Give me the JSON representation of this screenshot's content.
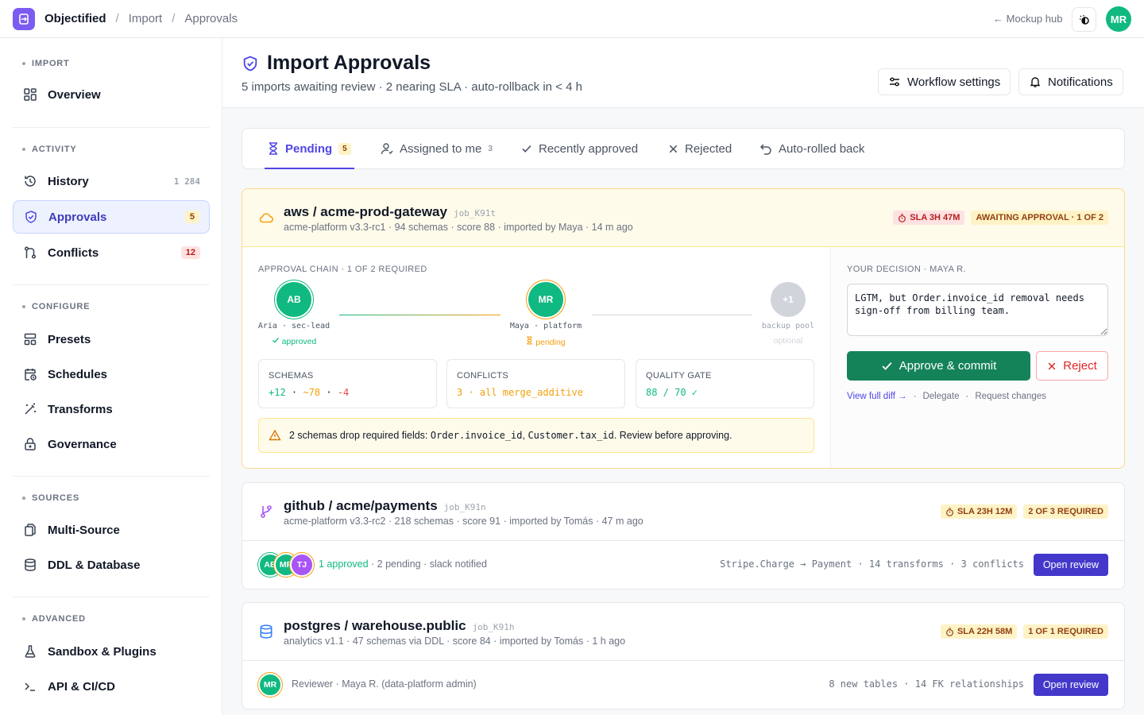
{
  "topbar": {
    "app_name": "Objectified",
    "crumb_import": "Import",
    "crumb_approvals": "Approvals",
    "separator": "/",
    "mockup_hub": "← Mockup hub",
    "user_initials": "MR"
  },
  "sidebar": {
    "sections": {
      "import": "IMPORT",
      "activity": "ACTIVITY",
      "configure": "CONFIGURE",
      "sources": "SOURCES",
      "advanced": "ADVANCED"
    },
    "items": {
      "overview": "Overview",
      "history": "History",
      "history_count": "1 284",
      "approvals": "Approvals",
      "approvals_count": "5",
      "conflicts": "Conflicts",
      "conflicts_count": "12",
      "presets": "Presets",
      "schedules": "Schedules",
      "transforms": "Transforms",
      "governance": "Governance",
      "multi_source": "Multi-Source",
      "ddl_database": "DDL & Database",
      "sandbox": "Sandbox & Plugins",
      "api": "API & CI/CD"
    }
  },
  "header": {
    "title": "Import Approvals",
    "subtitle": "5 imports awaiting review · 2 nearing SLA · auto-rollback in < 4 h",
    "workflow_btn": "Workflow settings",
    "notifications_btn": "Notifications"
  },
  "tabs": {
    "pending": "Pending",
    "pending_count": "5",
    "assigned": "Assigned to me",
    "assigned_count": "3",
    "recently_approved": "Recently approved",
    "rejected": "Rejected",
    "auto_rolled_back": "Auto-rolled back"
  },
  "card1": {
    "name": "aws / acme-prod-gateway",
    "job": "job_K91t",
    "meta": "acme-platform v3.3-rc1 · 94 schemas · score 88 · imported by Maya · 14 m ago",
    "sla": "SLA 3H 47M",
    "status": "AWAITING APPROVAL · 1 OF 2",
    "chain_label": "APPROVAL CHAIN · 1 OF 2 REQUIRED",
    "approvers": [
      {
        "initials": "AB",
        "name": "Aria · sec-lead",
        "status": "approved"
      },
      {
        "initials": "MR",
        "name": "Maya · platform",
        "status": "pending"
      },
      {
        "initials": "+1",
        "name": "backup pool",
        "status": "optional"
      }
    ],
    "stats": {
      "schemas_label": "SCHEMAS",
      "schemas_add": "+12",
      "schemas_mod": "~78",
      "schemas_del": "-4",
      "dot": "·",
      "conflicts_label": "CONFLICTS",
      "conflicts_value": "3 · all merge_additive",
      "quality_label": "QUALITY GATE",
      "quality_value": "88 / 70 ✓"
    },
    "warning": {
      "lead": "2 schemas drop required fields:",
      "field1": "Order.invoice_id",
      "comma": ",",
      "field2": "Customer.tax_id",
      "tail": ". Review before approving."
    },
    "decision": {
      "label": "YOUR DECISION · MAYA R.",
      "note": "LGTM, but Order.invoice_id removal needs sign-off from billing team.",
      "approve": "Approve & commit",
      "reject": "Reject",
      "view_diff": "View full diff →",
      "delegate": "Delegate",
      "request_changes": "Request changes",
      "sep": "·"
    }
  },
  "card2": {
    "name": "github / acme/payments",
    "job": "job_K91n",
    "meta": "acme-platform v3.3-rc2 · 218 schemas · score 91 · imported by Tomás · 47 m ago",
    "sla": "SLA 23H 12M",
    "status": "2 OF 3 REQUIRED",
    "avatars": [
      "AB",
      "MR",
      "TJ"
    ],
    "approved": "1 approved",
    "rest": "· 2 pending · slack notified",
    "right": "Stripe.Charge → Payment · 14 transforms · 3 conflicts",
    "open": "Open review"
  },
  "card3": {
    "name": "postgres / warehouse.public",
    "job": "job_K91h",
    "meta": "analytics v1.1 · 47 schemas via DDL · score 84 · imported by Tomás · 1 h ago",
    "sla": "SLA 22H 58M",
    "status": "1 OF 1 REQUIRED",
    "avatar": "MR",
    "reviewer": "Reviewer · Maya R. (data-platform admin)",
    "right": "8 new tables · 14 FK relationships",
    "open": "Open review"
  },
  "colors": {
    "accent": "#4f46e5",
    "approve": "#15835a",
    "reject": "#dc2626",
    "amber": "#f59e0b",
    "green": "#10b981"
  }
}
